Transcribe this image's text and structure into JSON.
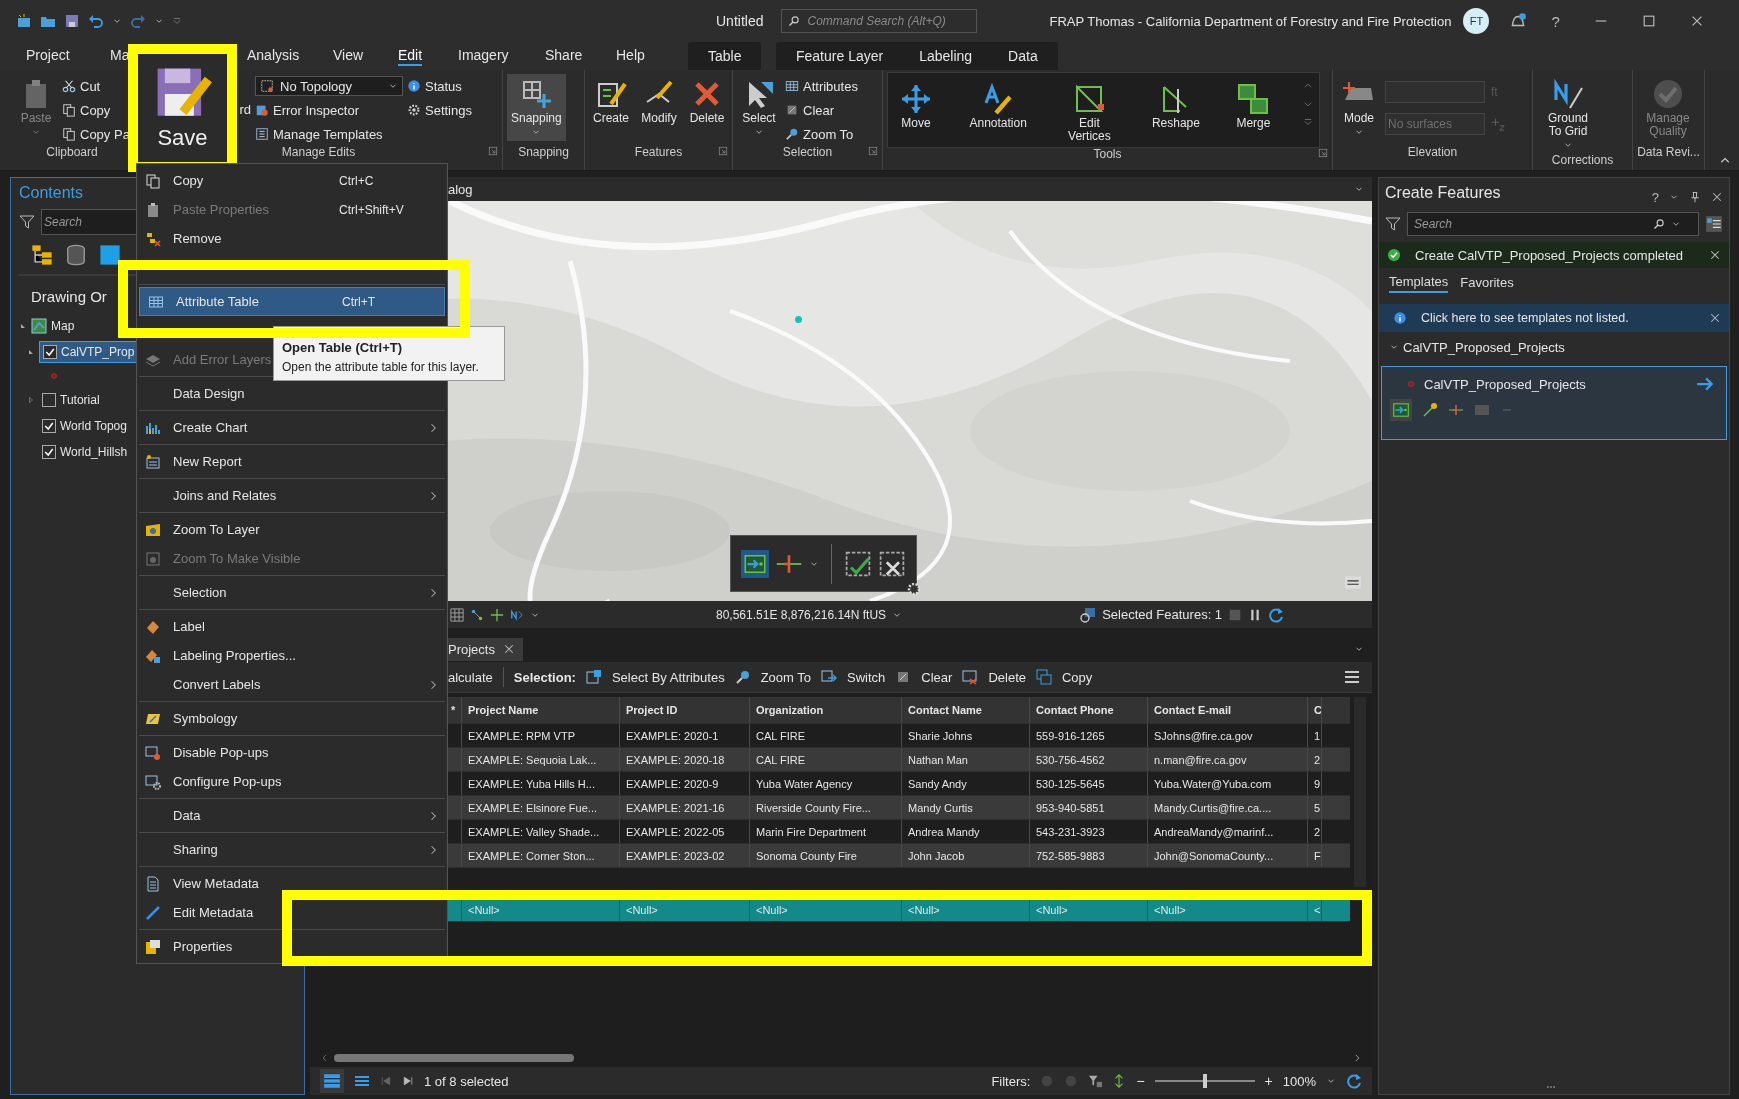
{
  "title_bar": {
    "document": "Untitled",
    "search_placeholder": "Command Search (Alt+Q)",
    "user": "FRAP Thomas - California Department of Forestry and Fire Protection",
    "avatar": "FT",
    "help": "?"
  },
  "tabs": [
    {
      "label": "Project",
      "selected": false
    },
    {
      "label": "Ma",
      "selected": false
    },
    {
      "label": "Analysis",
      "selected": false
    },
    {
      "label": "View",
      "selected": false
    },
    {
      "label": "Edit",
      "selected": true
    },
    {
      "label": "Imagery",
      "selected": false
    },
    {
      "label": "Share",
      "selected": false
    },
    {
      "label": "Help",
      "selected": false
    }
  ],
  "context_tab_groups": [
    {
      "tabs": [
        "Table"
      ]
    },
    {
      "tabs": [
        "Feature Layer",
        "Labeling",
        "Data"
      ]
    }
  ],
  "ribbon": {
    "groups": [
      {
        "label": "Clipboard",
        "items": [
          {
            "kind": "large",
            "label": "Paste",
            "disabled": true,
            "dropdown": true
          },
          {
            "kind": "small",
            "label": "Cut"
          },
          {
            "kind": "small",
            "label": "Copy"
          },
          {
            "kind": "small",
            "label": "Copy Pa"
          }
        ]
      },
      {
        "label": "Manage Edits",
        "items": [
          {
            "kind": "stub",
            "label": "rd"
          },
          {
            "kind": "combo",
            "label": "No Topology"
          },
          {
            "kind": "small",
            "label": "Error Inspector"
          },
          {
            "kind": "small",
            "label": "Manage Templates"
          },
          {
            "kind": "small",
            "label": "Status"
          },
          {
            "kind": "small",
            "label": "Settings"
          }
        ]
      },
      {
        "label": "Snapping",
        "items": [
          {
            "kind": "large",
            "label": "Snapping",
            "dropdown": true,
            "selected": true
          }
        ]
      },
      {
        "label": "Features",
        "items": [
          {
            "kind": "large",
            "label": "Create"
          },
          {
            "kind": "large",
            "label": "Modify"
          },
          {
            "kind": "large",
            "label": "Delete"
          }
        ]
      },
      {
        "label": "Selection",
        "items": [
          {
            "kind": "large",
            "label": "Select",
            "dropdown": true
          },
          {
            "kind": "small",
            "label": "Attributes"
          },
          {
            "kind": "small",
            "label": "Clear"
          },
          {
            "kind": "small",
            "label": "Zoom To"
          }
        ]
      },
      {
        "label": "Tools",
        "items": [
          {
            "kind": "large",
            "label": "Move"
          },
          {
            "kind": "large",
            "label": "Annotation"
          },
          {
            "kind": "large",
            "label": "Edit Vertices"
          },
          {
            "kind": "large",
            "label": "Reshape"
          },
          {
            "kind": "large",
            "label": "Merge"
          }
        ]
      },
      {
        "label": "Elevation",
        "items": [
          {
            "kind": "large",
            "label": "Mode",
            "dropdown": true
          },
          {
            "kind": "field",
            "unit": "ft",
            "disabled": true
          },
          {
            "kind": "field",
            "placeholder": "No surfaces",
            "disabled": true
          }
        ]
      },
      {
        "label": "Corrections",
        "items": [
          {
            "kind": "large",
            "label": "Ground To Grid",
            "dropdown": true
          }
        ]
      },
      {
        "label": "Data Revi...",
        "items": [
          {
            "kind": "large",
            "label": "Manage Quality",
            "disabled": true
          }
        ]
      }
    ]
  },
  "save_button": {
    "label": "Save"
  },
  "contents": {
    "title": "Contents",
    "search_placeholder": "Search",
    "section": "Drawing Or",
    "tree": [
      {
        "label": "Map",
        "expanded": true,
        "children": [
          {
            "label": "CalVTP_Prop",
            "checked": true,
            "selected": true,
            "expanded": true
          },
          {
            "label": "Tutorial",
            "checked": false,
            "selected": false,
            "expanded": false
          },
          {
            "label": "World Topog",
            "checked": true,
            "selected": false
          },
          {
            "label": "World_Hillsh",
            "checked": true,
            "selected": false
          }
        ]
      }
    ]
  },
  "context_menu": {
    "items": [
      {
        "label": "Copy",
        "shortcut": "Ctrl+C",
        "disabled": false,
        "selected": false,
        "submenu": false
      },
      {
        "label": "Paste Properties",
        "shortcut": "Ctrl+Shift+V",
        "disabled": true,
        "selected": false,
        "submenu": false
      },
      {
        "label": "Remove",
        "disabled": false,
        "selected": false,
        "submenu": false
      },
      {
        "label": "Attribute Table",
        "shortcut": "Ctrl+T",
        "disabled": false,
        "selected": true,
        "submenu": false
      },
      {
        "label": "Add Error Layers",
        "disabled": true,
        "selected": false,
        "submenu": false
      },
      {
        "label": "Data Design",
        "disabled": false,
        "selected": false,
        "submenu": false
      },
      {
        "label": "Create Chart",
        "disabled": false,
        "selected": false,
        "submenu": true
      },
      {
        "label": "New Report",
        "disabled": false,
        "selected": false,
        "submenu": false
      },
      {
        "label": "Joins and Relates",
        "disabled": false,
        "selected": false,
        "submenu": true
      },
      {
        "label": "Zoom To Layer",
        "disabled": false,
        "selected": false,
        "submenu": false
      },
      {
        "label": "Zoom To Make Visible",
        "disabled": true,
        "selected": false,
        "submenu": false
      },
      {
        "label": "Selection",
        "disabled": false,
        "selected": false,
        "submenu": true
      },
      {
        "label": "Label",
        "disabled": false,
        "selected": false,
        "submenu": false
      },
      {
        "label": "Labeling Properties...",
        "disabled": false,
        "selected": false,
        "submenu": false
      },
      {
        "label": "Convert Labels",
        "disabled": false,
        "selected": false,
        "submenu": true
      },
      {
        "label": "Symbology",
        "disabled": false,
        "selected": false,
        "submenu": false
      },
      {
        "label": "Disable Pop-ups",
        "disabled": false,
        "selected": false,
        "submenu": false
      },
      {
        "label": "Configure Pop-ups",
        "disabled": false,
        "selected": false,
        "submenu": false
      },
      {
        "label": "Data",
        "disabled": false,
        "selected": false,
        "submenu": true
      },
      {
        "label": "Sharing",
        "disabled": false,
        "selected": false,
        "submenu": true
      },
      {
        "label": "View Metadata",
        "disabled": false,
        "selected": false,
        "submenu": false
      },
      {
        "label": "Edit Metadata",
        "disabled": false,
        "selected": false,
        "submenu": false
      },
      {
        "label": "Properties",
        "disabled": false,
        "selected": false,
        "submenu": false
      }
    ]
  },
  "tooltip": {
    "title": "Open Table (Ctrl+T)",
    "text": "Open the attribute table for this layer."
  },
  "map": {
    "tab": "alog",
    "coordinates": "80,561.51E 8,876,216.14N ftUS",
    "selected_features": "Selected Features: 1"
  },
  "table": {
    "tab": "Projects",
    "toolbar_partial": "alculate",
    "selection_label": "Selection:",
    "actions": [
      "Select By Attributes",
      "Zoom To",
      "Switch",
      "Clear",
      "Delete",
      "Copy"
    ],
    "marker_column": "*",
    "columns": [
      "Project Name",
      "Project ID",
      "Organization",
      "Contact Name",
      "Contact Phone",
      "Contact E-mail",
      "C"
    ],
    "rows": [
      {
        "selected": false,
        "cells": [
          "EXAMPLE: RPM VTP",
          "EXAMPLE: 2020-1",
          "CAL FIRE",
          "Sharie Johns",
          "559-916-1265",
          "SJohns@fire.ca.gov",
          "1"
        ]
      },
      {
        "selected": false,
        "cells": [
          "EXAMPLE: Sequoia Lak...",
          "EXAMPLE: 2020-18",
          "CAL FIRE",
          "Nathan Man",
          "530-756-4562",
          "n.man@fire.ca.gov",
          "2"
        ]
      },
      {
        "selected": false,
        "cells": [
          "EXAMPLE: Yuba Hills H...",
          "EXAMPLE: 2020-9",
          "Yuba Water Agency",
          "Sandy Andy",
          "530-125-5645",
          "Yuba.Water@Yuba.com",
          "9"
        ]
      },
      {
        "selected": false,
        "cells": [
          "EXAMPLE: Elsinore Fue...",
          "EXAMPLE: 2021-16",
          "Riverside County Fire...",
          "Mandy Curtis",
          "953-940-5851",
          "Mandy.Curtis@fire.ca....",
          "5"
        ]
      },
      {
        "selected": false,
        "cells": [
          "EXAMPLE: Valley Shade...",
          "EXAMPLE: 2022-05",
          "Marin Fire Department",
          "Andrea Mandy",
          "543-231-3923",
          "AndreaMandy@marinf...",
          "2"
        ]
      },
      {
        "selected": false,
        "cells": [
          "EXAMPLE: Corner Ston...",
          "EXAMPLE: 2023-02",
          "Sonoma County Fire",
          "John Jacob",
          "752-585-9883",
          "John@SonomaCounty...",
          "F"
        ]
      },
      {
        "selected": true,
        "cells": [
          "<Null>",
          "<Null>",
          "<Null>",
          "<Null>",
          "<Null>",
          "<Null>",
          "<"
        ]
      }
    ],
    "status": "1 of 8 selected",
    "filters_label": "Filters:",
    "zoom_out": "−",
    "zoom_slider": {
      "level": 0.5
    },
    "zoom_in": "+",
    "zoom": "100%"
  },
  "create_features": {
    "title": "Create Features",
    "help": "?",
    "search_placeholder": "Search",
    "notice": "Create CalVTP_Proposed_Projects completed",
    "tabs": [
      {
        "label": "Templates",
        "selected": true
      },
      {
        "label": "Favorites",
        "selected": false
      }
    ],
    "info": "Click here to see templates not listed.",
    "group": {
      "label": "CalVTP_Proposed_Projects",
      "expanded": true
    },
    "template": {
      "label": "CalVTP_Proposed_Projects",
      "selected": true
    }
  }
}
